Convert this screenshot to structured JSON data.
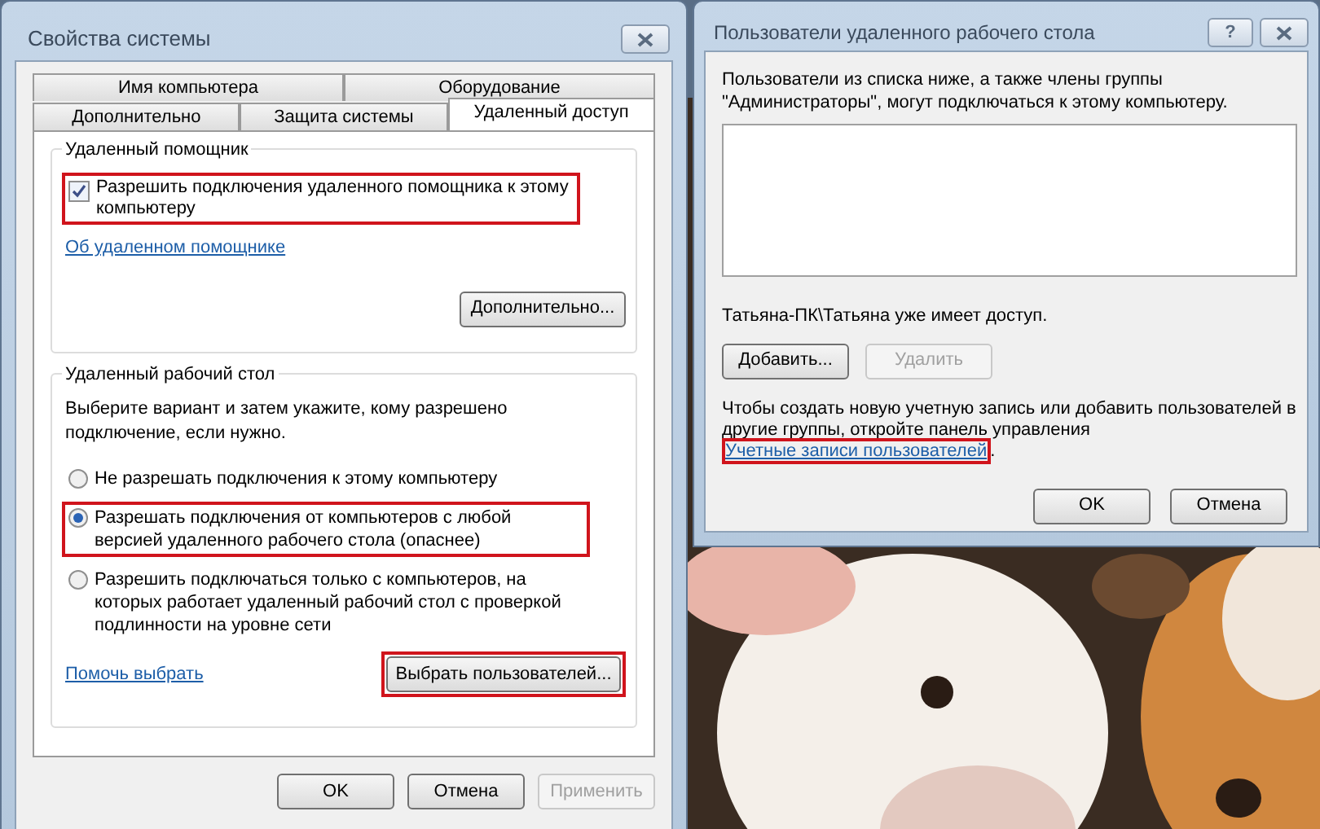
{
  "system_properties": {
    "title": "Свойства системы",
    "tab_rows": [
      [
        {
          "label": "Имя компьютера",
          "selected": false
        },
        {
          "label": "Оборудование",
          "selected": false
        }
      ],
      [
        {
          "label": "Дополнительно",
          "selected": false
        },
        {
          "label": "Защита системы",
          "selected": false
        },
        {
          "label": "Удаленный доступ",
          "selected": true
        }
      ]
    ],
    "remote_assistance": {
      "title": "Удаленный помощник",
      "checkbox": {
        "label": "Разрешить подключения удаленного помощника к этому компьютеру",
        "checked": true,
        "highlighted": true
      },
      "link": "Об удаленном помощнике",
      "advanced_button": "Дополнительно..."
    },
    "remote_desktop": {
      "title": "Удаленный рабочий стол",
      "description": "Выберите вариант и затем укажите, кому разрешено подключение, если нужно.",
      "options": [
        {
          "label": "Не разрешать подключения к этому компьютеру",
          "selected": false,
          "highlighted": false
        },
        {
          "label": "Разрешать подключения от компьютеров с любой версией удаленного рабочего стола (опаснее)",
          "selected": true,
          "highlighted": true
        },
        {
          "label": "Разрешить подключаться только с компьютеров, на которых работает удаленный рабочий стол с проверкой подлинности на уровне сети",
          "selected": false,
          "highlighted": false
        }
      ],
      "help_link": "Помочь выбрать",
      "select_users_button": {
        "label": "Выбрать пользователей...",
        "highlighted": true
      }
    },
    "buttons": [
      {
        "label": "OK",
        "disabled": false
      },
      {
        "label": "Отмена",
        "disabled": false
      },
      {
        "label": "Применить",
        "disabled": true
      }
    ]
  },
  "users_dialog": {
    "title": "Пользователи удаленного рабочего стола",
    "help_button": "?",
    "description": "Пользователи из списка ниже, а также члены группы \"Администраторы\", могут подключаться к этому компьютеру.",
    "access_note": "Татьяна-ПК\\Татьяна уже имеет доступ.",
    "list_buttons": [
      {
        "label": "Добавить...",
        "disabled": false
      },
      {
        "label": "Удалить",
        "disabled": true
      }
    ],
    "footer_text": "Чтобы создать новую учетную запись или добавить пользователей в другие группы, откройте панель управления",
    "footer_link": {
      "label": "Учетные записи пользователей",
      "highlighted": true
    },
    "footer_end": ".",
    "buttons": [
      {
        "label": "OK",
        "disabled": false
      },
      {
        "label": "Отмена",
        "disabled": false
      }
    ]
  }
}
